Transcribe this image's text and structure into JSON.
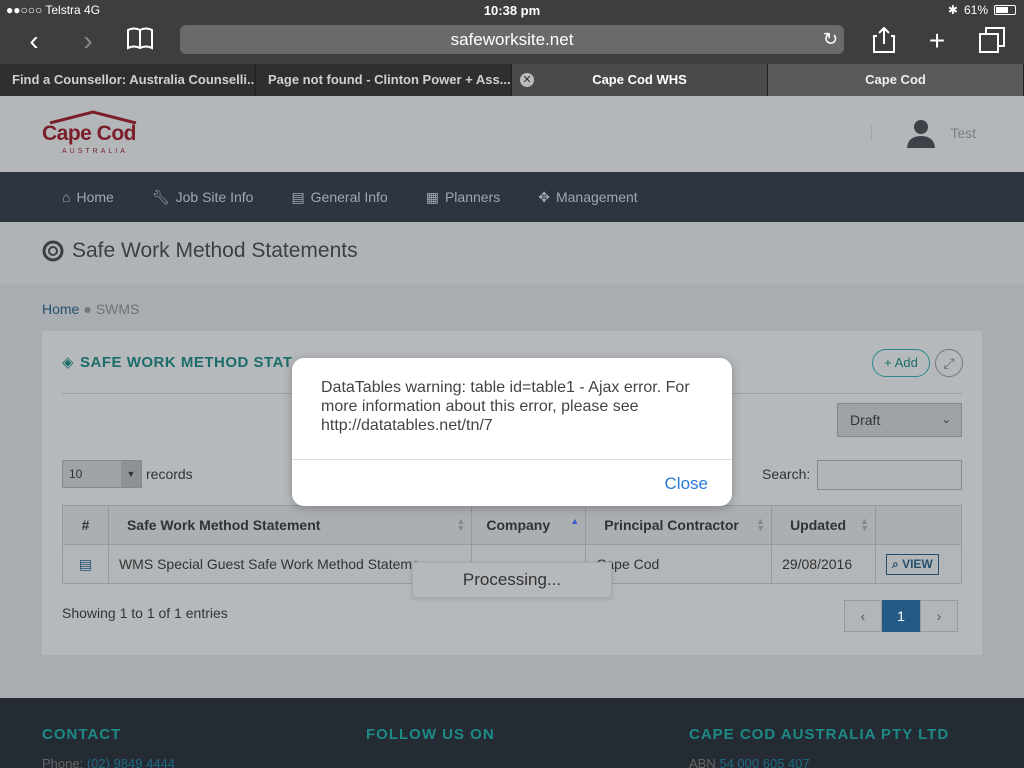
{
  "statusbar": {
    "carrier": "●●○○○ Telstra  4G",
    "time": "10:38 pm",
    "battery": "61%"
  },
  "browser": {
    "url": "safeworksite.net"
  },
  "tabs": [
    {
      "label": "Find a Counsellor: Australia Counselli..."
    },
    {
      "label": "Page not found - Clinton Power + Ass..."
    },
    {
      "label": "Cape Cod WHS"
    },
    {
      "label": "Cape Cod"
    }
  ],
  "logo": {
    "name": "Cape Cod",
    "sub": "AUSTRALIA"
  },
  "user": {
    "name": "Test"
  },
  "nav": [
    {
      "label": "Home",
      "icon": "home-icon"
    },
    {
      "label": "Job Site Info",
      "icon": "wrench-icon"
    },
    {
      "label": "General Info",
      "icon": "document-icon"
    },
    {
      "label": "Planners",
      "icon": "calendar-icon"
    },
    {
      "label": "Management",
      "icon": "move-icon"
    }
  ],
  "page": {
    "title": "Safe Work Method Statements"
  },
  "breadcrumb": {
    "home": "Home",
    "current": "SWMS"
  },
  "panel": {
    "title": "SAFE WORK METHOD STAT",
    "add_label": "Add",
    "status_filter": "Draft",
    "length": "10",
    "records_label": "records",
    "search_label": "Search:"
  },
  "table": {
    "headers": [
      "#",
      "Safe Work Method Statement",
      "Company",
      "Principal Contractor",
      "Updated",
      ""
    ],
    "rows": [
      {
        "statement": "WMS Special Guest Safe Work Method Stateme...",
        "company": "",
        "contractor": "Cape Cod",
        "updated": "29/08/2016",
        "action": "VIEW"
      }
    ]
  },
  "showing": "Showing 1 to 1 of 1 entries",
  "pager": {
    "prev": "‹",
    "page": "1",
    "next": "›"
  },
  "processing": "Processing...",
  "footer": {
    "contact": "CONTACT",
    "follow": "FOLLOW US ON",
    "company": "CAPE COD AUSTRALIA PTY LTD",
    "phone_label": "Phone: ",
    "phone": "(02) 9849 4444",
    "abn_label": "ABN ",
    "abn": "54 000 605 407"
  },
  "modal": {
    "message": "DataTables warning: table id=table1 - Ajax error. For more information about this error, please see http://datatables.net/tn/7",
    "close": "Close"
  }
}
